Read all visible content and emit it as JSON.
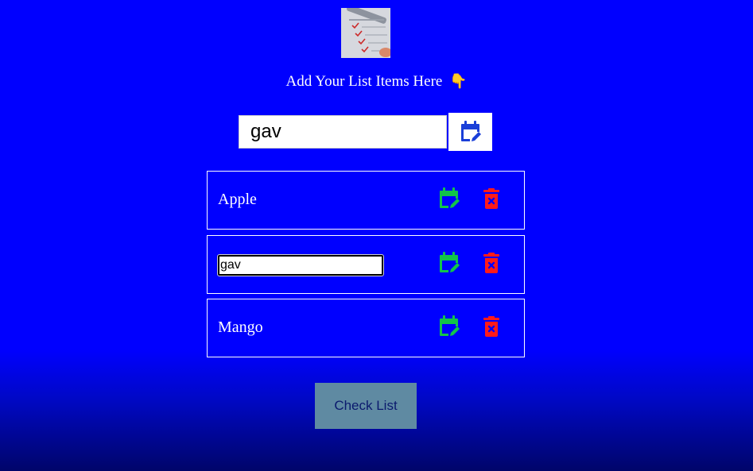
{
  "header": {
    "title": "Add Your List Items Here",
    "pointer_icon": "pointing-down-hand-icon",
    "logo_icon": "checklist-photo-icon"
  },
  "input": {
    "value": "gav",
    "add_button_icon": "calendar-edit-icon"
  },
  "items": [
    {
      "label": "Apple",
      "editing": false,
      "edit_icon": "calendar-edit-icon",
      "delete_icon": "trash-x-icon"
    },
    {
      "label": "gav",
      "editing": true,
      "edit_icon": "calendar-edit-icon",
      "delete_icon": "trash-x-icon"
    },
    {
      "label": "Mango",
      "editing": false,
      "edit_icon": "calendar-edit-icon",
      "delete_icon": "trash-x-icon"
    }
  ],
  "check_button": {
    "label": "Check List"
  },
  "colors": {
    "background": "#0000ff",
    "edit_icon": "#12c44a",
    "delete_icon": "#ff1a1a",
    "add_icon": "#1a3fd8",
    "check_button_bg": "#5f8aa2"
  }
}
